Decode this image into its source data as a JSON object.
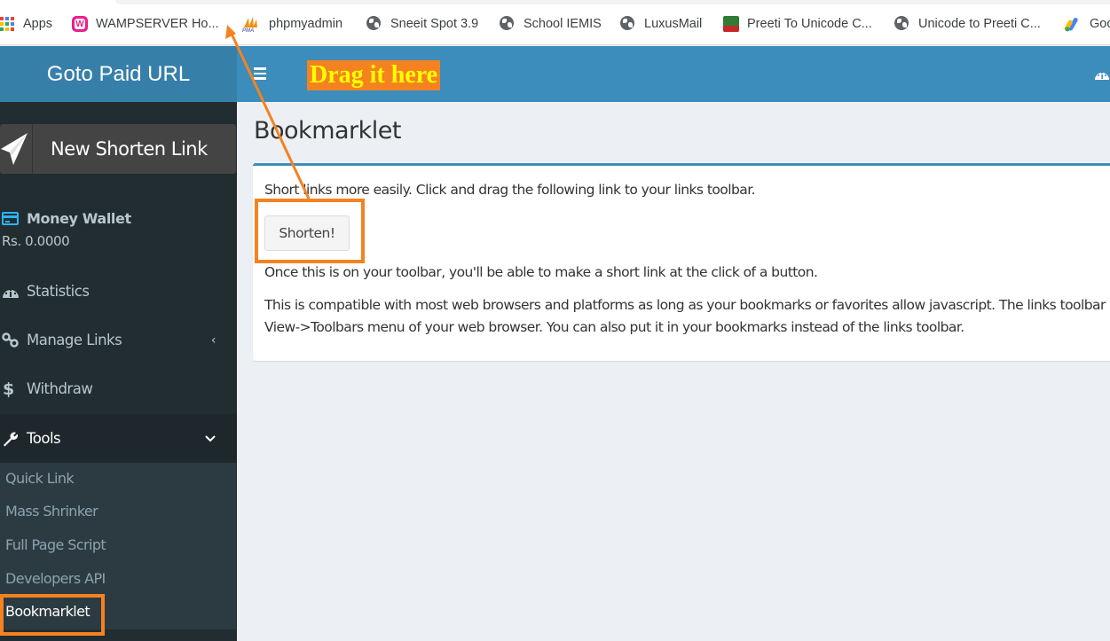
{
  "bookmarks": [
    {
      "label": "Apps",
      "icon": "apps-grid-icon"
    },
    {
      "label": "WAMPSERVER Ho...",
      "icon": "wampserver-icon"
    },
    {
      "label": "phpmyadmin",
      "icon": "phpmyadmin-icon"
    },
    {
      "label": "Sneeit Spot 3.9",
      "icon": "globe-icon"
    },
    {
      "label": "School IEMIS",
      "icon": "globe-icon"
    },
    {
      "label": "LuxusMail",
      "icon": "globe-icon"
    },
    {
      "label": "Preeti To Unicode C...",
      "icon": "preeti-icon"
    },
    {
      "label": "Unicode to Preeti C...",
      "icon": "globe-icon"
    },
    {
      "label": "Goo",
      "icon": "google-ads-icon"
    }
  ],
  "header": {
    "logo": "Goto Paid URL",
    "annotation": "Drag it here",
    "colors": {
      "logo_bg": "#367fa9",
      "topbar_bg": "#3c8dbc",
      "annotation_bg": "#f58220",
      "annotation_text": "#ffff00"
    }
  },
  "sidebar": {
    "new_link_label": "New Shorten Link",
    "wallet": {
      "label": "Money Wallet",
      "amount": "Rs. 0.0000"
    },
    "items": [
      {
        "label": "Statistics",
        "icon": "dashboard-icon"
      },
      {
        "label": "Manage Links",
        "icon": "link-icon",
        "chevron": "‹"
      },
      {
        "label": "Withdraw",
        "icon": "dollar-icon"
      },
      {
        "label": "Tools",
        "icon": "wrench-icon",
        "chevron": "⌄",
        "expanded": true
      }
    ],
    "tools_submenu": [
      {
        "label": "Quick Link"
      },
      {
        "label": "Mass Shrinker"
      },
      {
        "label": "Full Page Script"
      },
      {
        "label": "Developers API"
      },
      {
        "label": "Bookmarklet",
        "active": true
      }
    ]
  },
  "main": {
    "title": "Bookmarklet",
    "intro": "Short links more easily. Click and drag the following link to your links toolbar.",
    "button_label": "Shorten!",
    "after_button": "Once this is on your toolbar, you'll be able to make a short link at the click of a button.",
    "compat_line1": "This is compatible with most web browsers and platforms as long as your bookmarks or favorites allow javascript. The links toolbar",
    "compat_line2": "View->Toolbars menu of your web browser. You can also put it in your bookmarks instead of the links toolbar."
  },
  "annotation_color": "#f58220"
}
